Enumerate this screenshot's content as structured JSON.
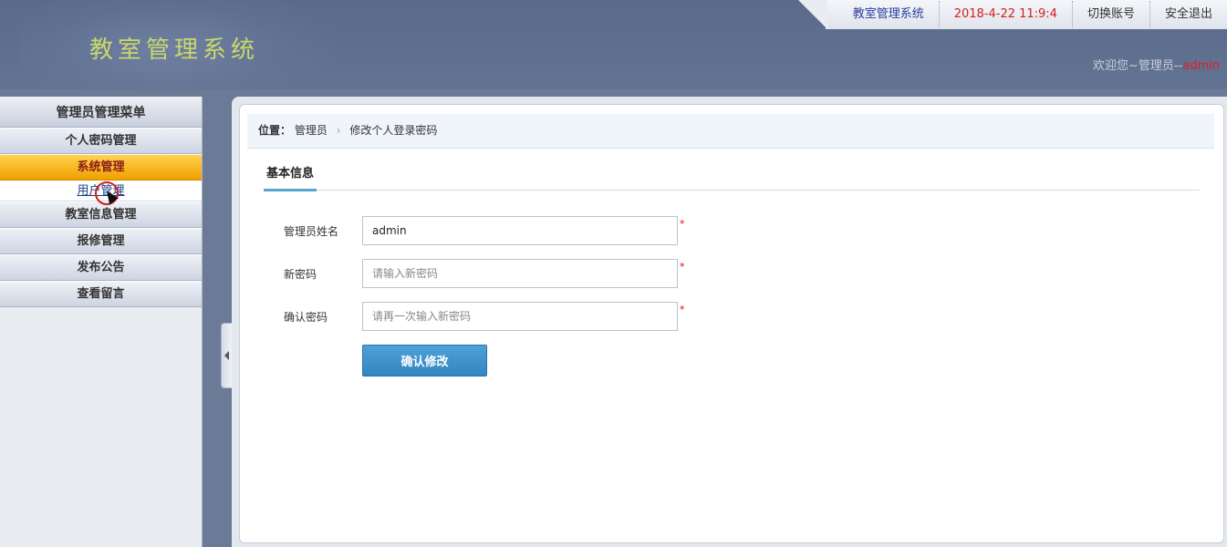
{
  "header": {
    "app_title": "教室管理系统",
    "top_links": {
      "system": "教室管理系统",
      "datetime": "2018-4-22 11:9:4",
      "switch_account": "切换账号",
      "logout": "安全退出"
    },
    "welcome_prefix": "欢迎您~管理员--",
    "welcome_user": "admin"
  },
  "sidebar": {
    "title": "管理员管理菜单",
    "groups": [
      {
        "label": "个人密码管理"
      },
      {
        "label": "系统管理",
        "active": true,
        "children": [
          {
            "label": "用户管理"
          }
        ]
      },
      {
        "label": "教室信息管理"
      },
      {
        "label": "报修管理"
      },
      {
        "label": "发布公告"
      },
      {
        "label": "查看留言"
      }
    ]
  },
  "main": {
    "breadcrumb": {
      "label": "位置：",
      "items": [
        "管理员",
        "修改个人登录密码"
      ],
      "separator": "›"
    },
    "section_tab": "基本信息",
    "form": {
      "fields": [
        {
          "label": "管理员姓名",
          "value": "admin",
          "placeholder": "",
          "required_mark": "*"
        },
        {
          "label": "新密码",
          "value": "",
          "placeholder": "请输入新密码",
          "required_mark": "*"
        },
        {
          "label": "确认密码",
          "value": "",
          "placeholder": "请再一次输入新密码",
          "required_mark": "*"
        }
      ],
      "submit_label": "确认修改"
    }
  },
  "colors": {
    "header_bg": "#5f6f8f",
    "app_title": "#c9d86a",
    "active_menu": "#f0a000",
    "button": "#3b8dc8",
    "date_text": "#d32020"
  }
}
